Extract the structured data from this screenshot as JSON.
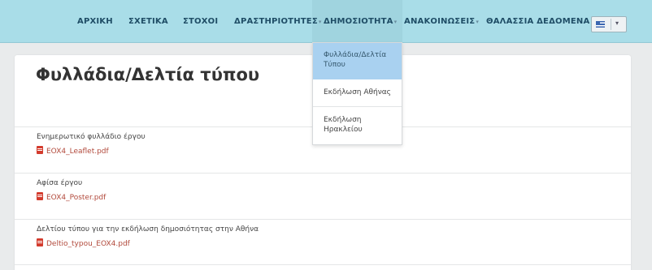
{
  "nav": {
    "items": [
      {
        "label": "ΑΡΧΙΚΗ",
        "has_caret": false
      },
      {
        "label": "ΣΧΕΤΙΚΑ",
        "has_caret": false
      },
      {
        "label": "ΣΤΟΧΟΙ",
        "has_caret": false
      },
      {
        "label": "ΔΡΑΣΤΗΡΙΟΤΗΤΕΣ",
        "has_caret": true
      },
      {
        "label": "ΔΗΜΟΣΙΟΤΗΤΑ",
        "has_caret": true
      },
      {
        "label": "ΑΝΑΚΟΙΝΩΣΕΙΣ",
        "has_caret": true
      },
      {
        "label": "ΘΑΛΑΣΣΙΑ ΔΕΔΟΜΕΝΑ",
        "has_caret": false
      }
    ],
    "caret": "▾",
    "language_flag": "greek-flag-icon",
    "language_arrow": "▾"
  },
  "dropdown": {
    "items": [
      {
        "label_line1": "Φυλλάδια/Δελτία",
        "label_line2": "Τύπου",
        "active": true
      },
      {
        "label_line1": "Εκδήλωση Αθήνας",
        "label_line2": "",
        "active": false
      },
      {
        "label_line1": "Εκδήλωση",
        "label_line2": "Ηρακλείου",
        "active": false
      }
    ]
  },
  "main": {
    "title": "Φυλλάδια/Δελτία τύπου",
    "rows": [
      {
        "label": "Ενημερωτικό φυλλάδιο έργου",
        "file": "EOX4_Leaflet.pdf"
      },
      {
        "label": "Αφίσα έργου",
        "file": "EOX4_Poster.pdf"
      },
      {
        "label": "Δελτίου τύπου για την εκδήλωση δημοσιότητας στην Αθήνα",
        "file": "Deltio_typou_EOX4.pdf"
      }
    ]
  },
  "colors": {
    "navbar_bg": "#a9dde8",
    "nav_text": "#1f4d66",
    "link": "#b24a3c",
    "dropdown_active_bg": "#a9d1f0"
  }
}
